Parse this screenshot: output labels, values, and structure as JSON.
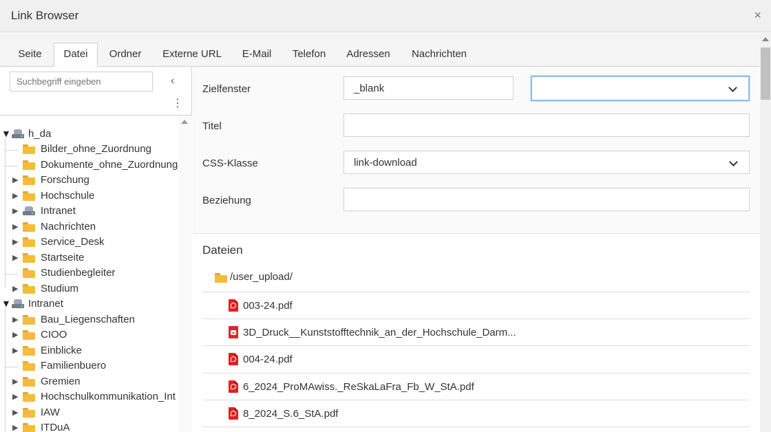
{
  "window": {
    "title": "Link Browser",
    "close_glyph": "×"
  },
  "tabs": [
    {
      "label": "Seite"
    },
    {
      "label": "Datei",
      "active": true
    },
    {
      "label": "Ordner"
    },
    {
      "label": "Externe URL"
    },
    {
      "label": "E-Mail"
    },
    {
      "label": "Telefon"
    },
    {
      "label": "Adressen"
    },
    {
      "label": "Nachrichten"
    }
  ],
  "sidebar": {
    "search_placeholder": "Suchbegriff eingeben",
    "collapse_glyph": "‹",
    "menu_glyph": "⋮",
    "tree": [
      {
        "label": "h_da",
        "icon": "storage-mount-icon",
        "expander": "open"
      },
      {
        "label": "Bilder_ohne_Zuordnung",
        "icon": "folder-icon",
        "expander": "none"
      },
      {
        "label": "Dokumente_ohne_Zuordnung",
        "icon": "folder-icon",
        "expander": "none"
      },
      {
        "label": "Forschung",
        "icon": "folder-icon",
        "expander": "closed"
      },
      {
        "label": "Hochschule",
        "icon": "folder-icon",
        "expander": "closed"
      },
      {
        "label": "Intranet",
        "icon": "storage-mount-icon",
        "expander": "closed"
      },
      {
        "label": "Nachrichten",
        "icon": "folder-icon",
        "expander": "closed"
      },
      {
        "label": "Service_Desk",
        "icon": "folder-icon",
        "expander": "closed"
      },
      {
        "label": "Startseite",
        "icon": "folder-icon",
        "expander": "closed"
      },
      {
        "label": "Studienbegleiter",
        "icon": "folder-icon",
        "expander": "none"
      },
      {
        "label": "Studium",
        "icon": "folder-icon",
        "expander": "closed"
      },
      {
        "label": "Intranet",
        "icon": "storage-mount-icon",
        "expander": "open"
      },
      {
        "label": "Bau_Liegenschaften",
        "icon": "folder-icon",
        "expander": "closed"
      },
      {
        "label": "CIOO",
        "icon": "folder-icon",
        "expander": "closed"
      },
      {
        "label": "Einblicke",
        "icon": "folder-icon",
        "expander": "closed"
      },
      {
        "label": "Familienbuero",
        "icon": "folder-icon",
        "expander": "none"
      },
      {
        "label": "Gremien",
        "icon": "folder-icon",
        "expander": "closed"
      },
      {
        "label": "Hochschulkommunikation_Int",
        "icon": "folder-icon",
        "expander": "closed"
      },
      {
        "label": "IAW",
        "icon": "folder-icon",
        "expander": "closed"
      },
      {
        "label": "ITDuA",
        "icon": "folder-icon",
        "expander": "closed"
      }
    ]
  },
  "form": {
    "target": {
      "label": "Zielfenster",
      "value": "_blank",
      "select_value": ""
    },
    "title": {
      "label": "Titel",
      "value": ""
    },
    "css_class": {
      "label": "CSS-Klasse",
      "value": "link-download"
    },
    "relation": {
      "label": "Beziehung",
      "value": ""
    }
  },
  "files": {
    "heading": "Dateien",
    "folder_path": "/user_upload/",
    "items": [
      {
        "name": "003-24.pdf",
        "icon": "pdf-file-icon"
      },
      {
        "name": "3D_Druck__Kunststofftechnik_an_der_Hochschule_Darm...",
        "icon": "video-file-icon"
      },
      {
        "name": "004-24.pdf",
        "icon": "pdf-file-icon"
      },
      {
        "name": "6_2024_ProMAwiss._ReSkaLaFra_Fb_W_StA.pdf",
        "icon": "pdf-file-icon"
      },
      {
        "name": "8_2024_S.6_StA.pdf",
        "icon": "pdf-file-icon"
      }
    ]
  },
  "colors": {
    "folder": "#f5bb3b",
    "pdf": "#e02020",
    "focus_border": "#8fbcf0"
  }
}
